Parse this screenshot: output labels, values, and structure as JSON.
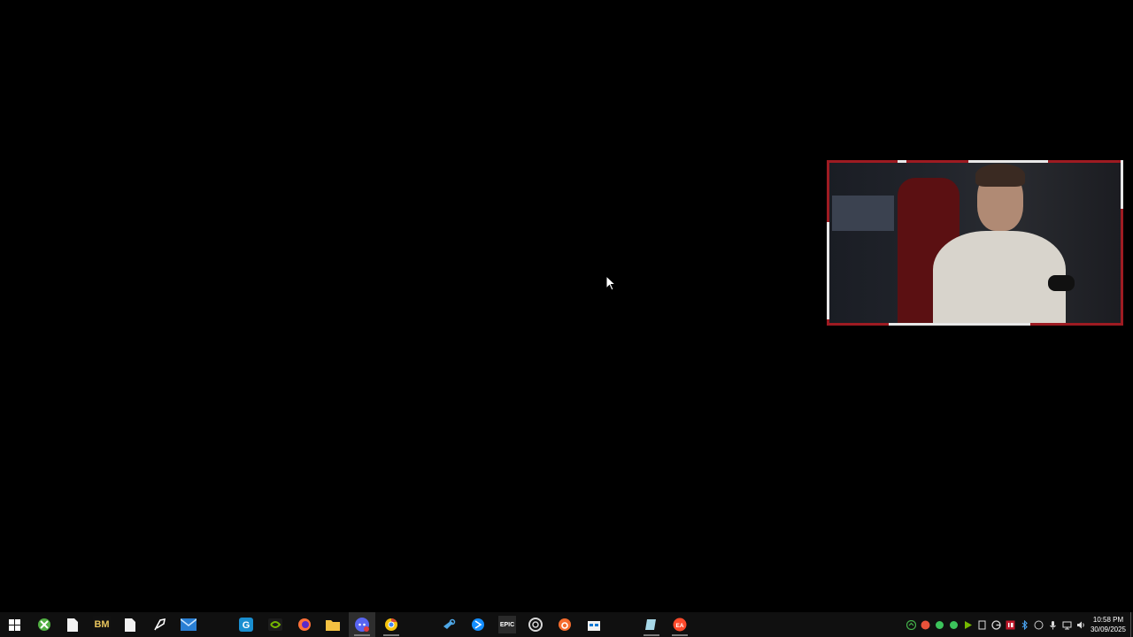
{
  "taskbar": {
    "clock": {
      "time": "10:58 PM",
      "date": "30/09/2025"
    },
    "pinned_icons": [
      "windows-start-icon",
      "xbox-icon",
      "file-icon",
      "bm-icon",
      "document-icon",
      "feather-icon",
      "mail-icon",
      "grammarly-icon",
      "nvidia-icon",
      "firefox-icon",
      "file-explorer-icon",
      "discord-icon",
      "chrome-icon",
      "steam-icon",
      "battlenet-icon",
      "epic-games-icon",
      "ubisoft-connect-icon",
      "origin-icon",
      "store-icon",
      "notepad-icon",
      "ea-app-icon"
    ],
    "icon_labels": {
      "bm": "BM",
      "epic": "EPIC",
      "ea": "EA"
    },
    "colors": {
      "background": "#101010",
      "active": "#2e2e2e"
    }
  },
  "webcam": {
    "border_color": "#9e1b22"
  }
}
